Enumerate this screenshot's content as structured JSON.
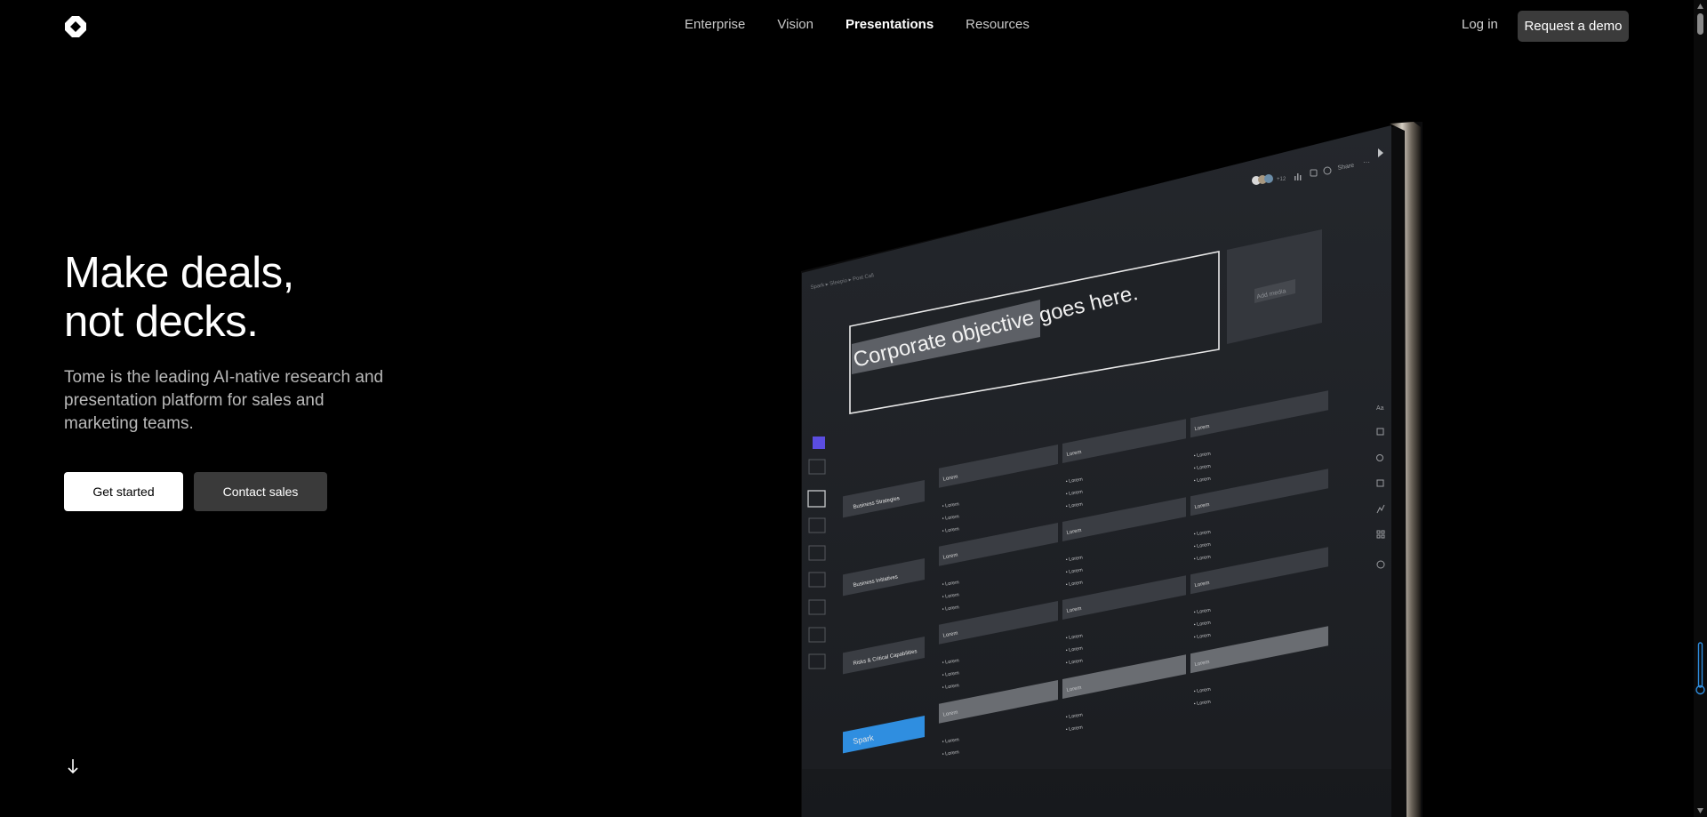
{
  "nav": {
    "links": [
      "Enterprise",
      "Vision",
      "Presentations",
      "Resources"
    ],
    "active": "Presentations",
    "login": "Log in",
    "demo": "Request a demo"
  },
  "hero": {
    "title_line1": "Make deals,",
    "title_line2": "not decks.",
    "subtitle": "Tome is the leading AI-native research and presentation platform for sales and marketing teams.",
    "cta_primary": "Get started",
    "cta_secondary": "Contact sales"
  },
  "mockup": {
    "topbar": {
      "share": "Share",
      "more": "···",
      "avatar_count": "+12"
    },
    "breadcrumb": "Spark ▸ Sleepio ▸ Post Call",
    "objective": "Corporate objective goes here.",
    "add_media": "Add media",
    "rows": [
      {
        "label": "Business Strategies",
        "cells": [
          "Lorem",
          "Lorem",
          "Lorem"
        ],
        "bullets": [
          [
            "Lorem",
            "Lorem",
            "Lorem"
          ],
          [
            "Lorem",
            "Lorem",
            "Lorem"
          ],
          [
            "Lorem",
            "Lorem",
            "Lorem"
          ]
        ]
      },
      {
        "label": "Business Initiatives",
        "cells": [
          "Lorem",
          "Lorem",
          "Lorem"
        ],
        "bullets": [
          [
            "Lorem",
            "Lorem",
            "Lorem"
          ],
          [
            "Lorem",
            "Lorem",
            "Lorem"
          ],
          [
            "Lorem",
            "Lorem",
            "Lorem"
          ]
        ]
      },
      {
        "label": "Risks & Critical Capabilities",
        "cells": [
          "Lorem",
          "Lorem",
          "Lorem"
        ],
        "bullets": [
          [
            "Lorem",
            "Lorem",
            "Lorem"
          ],
          [
            "Lorem",
            "Lorem",
            "Lorem"
          ],
          [
            "Lorem",
            "Lorem",
            "Lorem"
          ]
        ]
      },
      {
        "label": "Spark",
        "cells": [
          "Lorem",
          "Lorem",
          "Lorem"
        ],
        "bullets": [
          [
            "Lorem",
            "Lorem"
          ],
          [
            "Lorem",
            "Lorem"
          ],
          [
            "Lorem",
            "Lorem"
          ]
        ]
      }
    ],
    "toolbar_icons": [
      "text-style-icon",
      "image-icon",
      "link-icon",
      "table-icon",
      "chart-icon",
      "apps-icon",
      "theme-icon"
    ]
  },
  "colors": {
    "accent_blue": "#2f8ee0",
    "button_dark": "#3b3b3b",
    "mock_bg": "#1e2126"
  }
}
